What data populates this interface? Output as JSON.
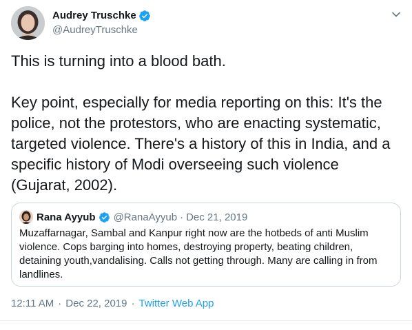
{
  "author": {
    "name": "Audrey Truschke",
    "handle": "@AudreyTruschke",
    "verified": true
  },
  "tweet": {
    "paragraphs": [
      "This is turning into a blood bath.",
      "Key point, especially for media reporting on this: It's the police, not the protestors, who are enacting systematic, targeted violence. There's a history of this in India, and a specific history of Modi overseeing such violence (Gujarat, 2002)."
    ]
  },
  "quoted_tweet": {
    "name": "Rana Ayyub",
    "handle": "@RanaAyyub",
    "separator": "·",
    "date": "Dec 21, 2019",
    "verified": true,
    "text": "Muzaffarnagar, Sambal and Kanpur right now are the hotbeds of anti Muslim violence. Cops barging into homes, destroying property, beating children, detaining youth,vandalising. Calls not getting through. Many are calling in from landlines."
  },
  "meta": {
    "time": "12:11 AM",
    "separator_1": "·",
    "date": "Dec 22, 2019",
    "separator_2": "·",
    "source": "Twitter Web App"
  },
  "icons": {
    "verified": "verified-badge-icon",
    "menu": "chevron-down-icon"
  },
  "colors": {
    "text": "#14171a",
    "secondary": "#657786",
    "accent": "#1da1f2",
    "border": "#ccd6dd"
  }
}
